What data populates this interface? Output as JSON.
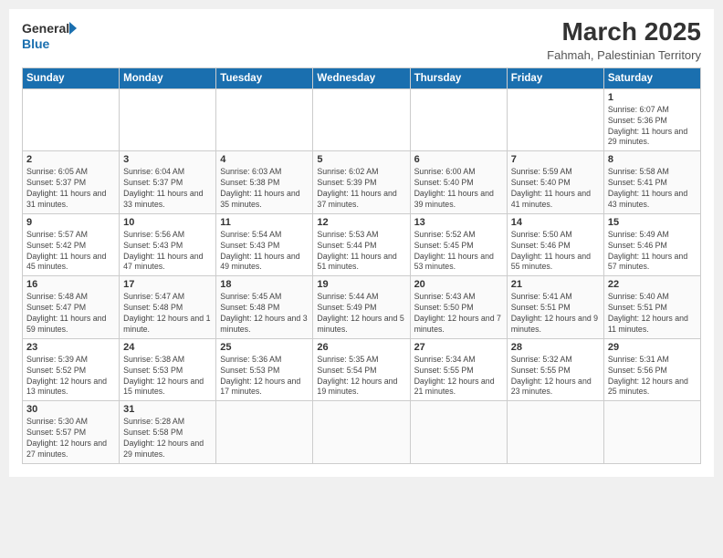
{
  "header": {
    "logo_general": "General",
    "logo_blue": "Blue",
    "title": "March 2025",
    "subtitle": "Fahmah, Palestinian Territory"
  },
  "weekdays": [
    "Sunday",
    "Monday",
    "Tuesday",
    "Wednesday",
    "Thursday",
    "Friday",
    "Saturday"
  ],
  "weeks": [
    [
      {
        "day": "",
        "info": ""
      },
      {
        "day": "",
        "info": ""
      },
      {
        "day": "",
        "info": ""
      },
      {
        "day": "",
        "info": ""
      },
      {
        "day": "",
        "info": ""
      },
      {
        "day": "",
        "info": ""
      },
      {
        "day": "1",
        "info": "Sunrise: 6:07 AM\nSunset: 5:36 PM\nDaylight: 11 hours and 29 minutes."
      }
    ],
    [
      {
        "day": "2",
        "info": "Sunrise: 6:05 AM\nSunset: 5:37 PM\nDaylight: 11 hours and 31 minutes."
      },
      {
        "day": "3",
        "info": "Sunrise: 6:04 AM\nSunset: 5:37 PM\nDaylight: 11 hours and 33 minutes."
      },
      {
        "day": "4",
        "info": "Sunrise: 6:03 AM\nSunset: 5:38 PM\nDaylight: 11 hours and 35 minutes."
      },
      {
        "day": "5",
        "info": "Sunrise: 6:02 AM\nSunset: 5:39 PM\nDaylight: 11 hours and 37 minutes."
      },
      {
        "day": "6",
        "info": "Sunrise: 6:00 AM\nSunset: 5:40 PM\nDaylight: 11 hours and 39 minutes."
      },
      {
        "day": "7",
        "info": "Sunrise: 5:59 AM\nSunset: 5:40 PM\nDaylight: 11 hours and 41 minutes."
      },
      {
        "day": "8",
        "info": "Sunrise: 5:58 AM\nSunset: 5:41 PM\nDaylight: 11 hours and 43 minutes."
      }
    ],
    [
      {
        "day": "9",
        "info": "Sunrise: 5:57 AM\nSunset: 5:42 PM\nDaylight: 11 hours and 45 minutes."
      },
      {
        "day": "10",
        "info": "Sunrise: 5:56 AM\nSunset: 5:43 PM\nDaylight: 11 hours and 47 minutes."
      },
      {
        "day": "11",
        "info": "Sunrise: 5:54 AM\nSunset: 5:43 PM\nDaylight: 11 hours and 49 minutes."
      },
      {
        "day": "12",
        "info": "Sunrise: 5:53 AM\nSunset: 5:44 PM\nDaylight: 11 hours and 51 minutes."
      },
      {
        "day": "13",
        "info": "Sunrise: 5:52 AM\nSunset: 5:45 PM\nDaylight: 11 hours and 53 minutes."
      },
      {
        "day": "14",
        "info": "Sunrise: 5:50 AM\nSunset: 5:46 PM\nDaylight: 11 hours and 55 minutes."
      },
      {
        "day": "15",
        "info": "Sunrise: 5:49 AM\nSunset: 5:46 PM\nDaylight: 11 hours and 57 minutes."
      }
    ],
    [
      {
        "day": "16",
        "info": "Sunrise: 5:48 AM\nSunset: 5:47 PM\nDaylight: 11 hours and 59 minutes."
      },
      {
        "day": "17",
        "info": "Sunrise: 5:47 AM\nSunset: 5:48 PM\nDaylight: 12 hours and 1 minute."
      },
      {
        "day": "18",
        "info": "Sunrise: 5:45 AM\nSunset: 5:48 PM\nDaylight: 12 hours and 3 minutes."
      },
      {
        "day": "19",
        "info": "Sunrise: 5:44 AM\nSunset: 5:49 PM\nDaylight: 12 hours and 5 minutes."
      },
      {
        "day": "20",
        "info": "Sunrise: 5:43 AM\nSunset: 5:50 PM\nDaylight: 12 hours and 7 minutes."
      },
      {
        "day": "21",
        "info": "Sunrise: 5:41 AM\nSunset: 5:51 PM\nDaylight: 12 hours and 9 minutes."
      },
      {
        "day": "22",
        "info": "Sunrise: 5:40 AM\nSunset: 5:51 PM\nDaylight: 12 hours and 11 minutes."
      }
    ],
    [
      {
        "day": "23",
        "info": "Sunrise: 5:39 AM\nSunset: 5:52 PM\nDaylight: 12 hours and 13 minutes."
      },
      {
        "day": "24",
        "info": "Sunrise: 5:38 AM\nSunset: 5:53 PM\nDaylight: 12 hours and 15 minutes."
      },
      {
        "day": "25",
        "info": "Sunrise: 5:36 AM\nSunset: 5:53 PM\nDaylight: 12 hours and 17 minutes."
      },
      {
        "day": "26",
        "info": "Sunrise: 5:35 AM\nSunset: 5:54 PM\nDaylight: 12 hours and 19 minutes."
      },
      {
        "day": "27",
        "info": "Sunrise: 5:34 AM\nSunset: 5:55 PM\nDaylight: 12 hours and 21 minutes."
      },
      {
        "day": "28",
        "info": "Sunrise: 5:32 AM\nSunset: 5:55 PM\nDaylight: 12 hours and 23 minutes."
      },
      {
        "day": "29",
        "info": "Sunrise: 5:31 AM\nSunset: 5:56 PM\nDaylight: 12 hours and 25 minutes."
      }
    ],
    [
      {
        "day": "30",
        "info": "Sunrise: 5:30 AM\nSunset: 5:57 PM\nDaylight: 12 hours and 27 minutes."
      },
      {
        "day": "31",
        "info": "Sunrise: 5:28 AM\nSunset: 5:58 PM\nDaylight: 12 hours and 29 minutes."
      },
      {
        "day": "",
        "info": ""
      },
      {
        "day": "",
        "info": ""
      },
      {
        "day": "",
        "info": ""
      },
      {
        "day": "",
        "info": ""
      },
      {
        "day": "",
        "info": ""
      }
    ]
  ]
}
